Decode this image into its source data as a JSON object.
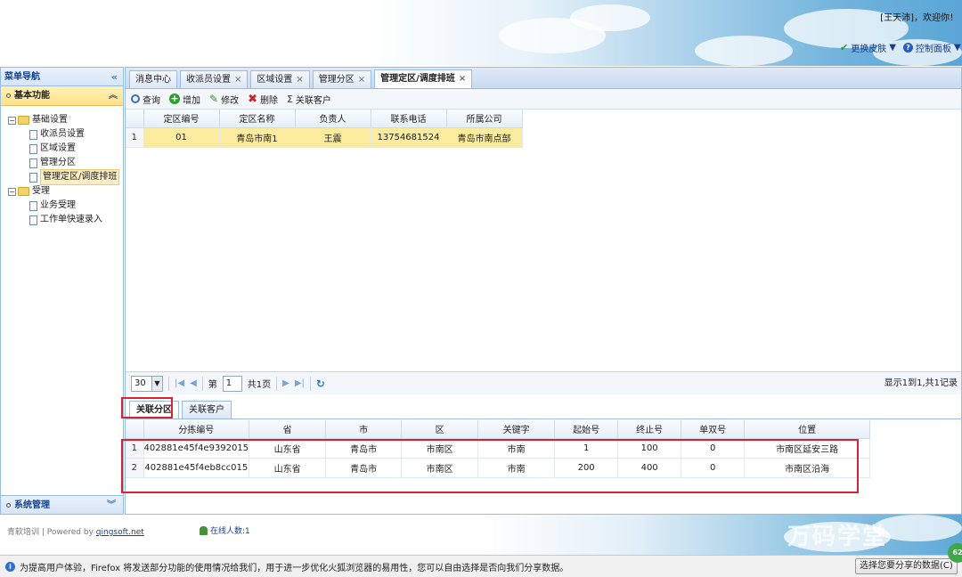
{
  "header": {
    "welcome": "[王天沛]，欢迎你！",
    "skin_label": "更换皮肤",
    "panel_label": "控制面板"
  },
  "nav": {
    "title": "菜单导航",
    "section_basic": "基本功能",
    "tree": {
      "basic_settings": "基础设置",
      "items": [
        "收派员设置",
        "区域设置",
        "管理分区",
        "管理定区/调度排班"
      ],
      "accept": "受理",
      "accept_items": [
        "业务受理",
        "工作单快速录入"
      ]
    },
    "section_system": "系统管理"
  },
  "tabs": [
    {
      "label": "消息中心",
      "closable": false
    },
    {
      "label": "收派员设置",
      "closable": true
    },
    {
      "label": "区域设置",
      "closable": true
    },
    {
      "label": "管理分区",
      "closable": true
    },
    {
      "label": "管理定区/调度排班",
      "closable": true
    }
  ],
  "toolbar": {
    "query": "查询",
    "add": "增加",
    "edit": "修改",
    "delete": "删除",
    "link_customer": "关联客户"
  },
  "main_grid": {
    "columns": [
      "定区编号",
      "定区名称",
      "负责人",
      "联系电话",
      "所属公司"
    ],
    "rows": [
      {
        "rownum": "1",
        "cells": [
          "01",
          "青岛市南1",
          "王震",
          "13754681524",
          "青岛市南点部"
        ]
      }
    ]
  },
  "pager": {
    "page_size": "30",
    "page_prefix": "第",
    "page_value": "1",
    "page_suffix": "共1页",
    "info": "显示1到1,共1记录"
  },
  "subtabs": [
    "关联分区",
    "关联客户"
  ],
  "sub_grid": {
    "columns": [
      "分拣编号",
      "省",
      "市",
      "区",
      "关键字",
      "起始号",
      "终止号",
      "单双号",
      "位置"
    ],
    "rows": [
      {
        "rownum": "1",
        "cells": [
          "402881e45f4e9392015",
          "山东省",
          "青岛市",
          "市南区",
          "市南",
          "1",
          "100",
          "0",
          "市南区延安三路"
        ]
      },
      {
        "rownum": "2",
        "cells": [
          "402881e45f4eb8cc015",
          "山东省",
          "青岛市",
          "市南区",
          "市南",
          "200",
          "400",
          "0",
          "市南区沿海"
        ]
      }
    ]
  },
  "footer": {
    "copyright": "青软培训 | Powered by ",
    "link": "qingsoft.net",
    "online": "在线人数:1",
    "watermark": "万码学堂"
  },
  "statusbar": {
    "message": "为提高用户体验，Firefox 将发送部分功能的使用情况给我们，用于进一步优化火狐浏览器的易用性，您可以自由选择是否向我们分享数据。",
    "button": "选择您要分享的数据(C)",
    "badge": "62"
  }
}
